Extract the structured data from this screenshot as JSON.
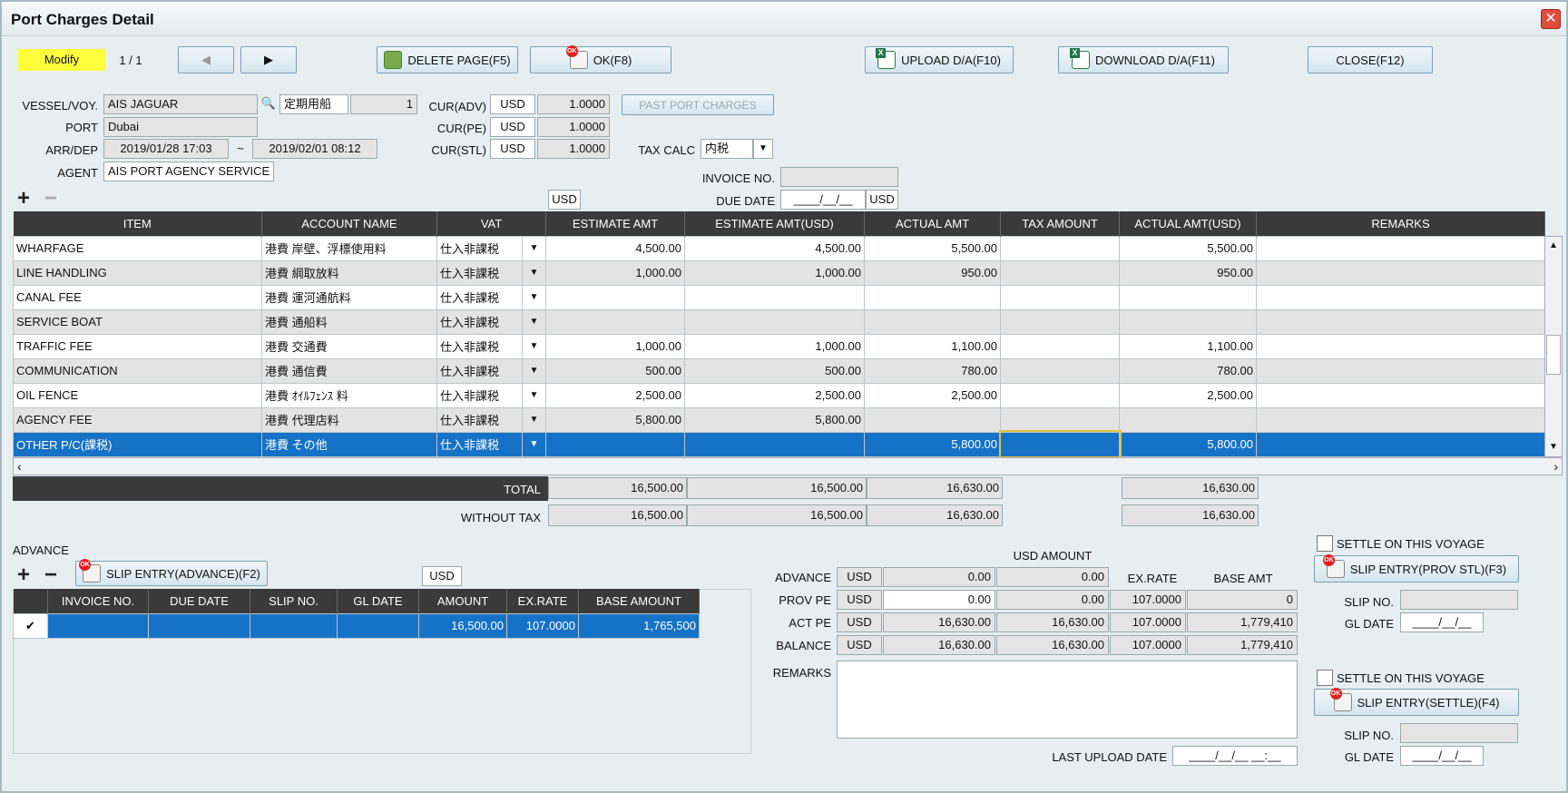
{
  "window": {
    "title": "Port Charges Detail",
    "close_glyph": "✕"
  },
  "toolbar": {
    "mode": "Modify",
    "page_counter": "1 / 1",
    "prev_glyph": "◀",
    "next_glyph": "▶",
    "delete_page": "DELETE PAGE(F5)",
    "ok": "OK(F8)",
    "upload": "UPLOAD D/A(F10)",
    "download": "DOWNLOAD D/A(F11)",
    "close": "CLOSE(F12)"
  },
  "header": {
    "vessel_label": "VESSEL/VOY.",
    "vessel": "AIS JAGUAR",
    "voyage_type": "定期用船",
    "voyage_no": "1",
    "port_label": "PORT",
    "port": "Dubai",
    "arrdep_label": "ARR/DEP",
    "arr": "2019/01/28 17:03",
    "tilde": "~",
    "dep": "2019/02/01 08:12",
    "agent_label": "AGENT",
    "agent": "AIS PORT AGENCY SERVICE",
    "cur_adv_label": "CUR(ADV)",
    "cur_adv": "USD",
    "rate_adv": "1.0000",
    "cur_pe_label": "CUR(PE)",
    "cur_pe": "USD",
    "rate_pe": "1.0000",
    "cur_stl_label": "CUR(STL)",
    "cur_stl": "USD",
    "rate_stl": "1.0000",
    "past_port_charges": "PAST PORT CHARGES",
    "tax_calc_label": "TAX CALC",
    "tax_calc": "内税",
    "invoice_no_label": "INVOICE NO.",
    "invoice_no": "",
    "due_date_label": "DUE DATE",
    "due_date": "____/__/__",
    "due_cur": "USD",
    "grid_cur": "USD"
  },
  "charges": {
    "columns": [
      "ITEM",
      "ACCOUNT NAME",
      "VAT",
      "ESTIMATE AMT",
      "ESTIMATE AMT(USD)",
      "ACTUAL AMT",
      "TAX AMOUNT",
      "ACTUAL AMT(USD)",
      "REMARKS"
    ],
    "rows": [
      {
        "item": "WHARFAGE",
        "account": "港費 岸壁、浮標使用料",
        "vat": "仕入非課税",
        "est": "4,500.00",
        "est_usd": "4,500.00",
        "act": "5,500.00",
        "tax": "",
        "act_usd": "5,500.00",
        "remarks": ""
      },
      {
        "item": "LINE HANDLING",
        "account": "港費 綱取放料",
        "vat": "仕入非課税",
        "est": "1,000.00",
        "est_usd": "1,000.00",
        "act": "950.00",
        "tax": "",
        "act_usd": "950.00",
        "remarks": ""
      },
      {
        "item": "CANAL FEE",
        "account": "港費 運河通航料",
        "vat": "仕入非課税",
        "est": "",
        "est_usd": "",
        "act": "",
        "tax": "",
        "act_usd": "",
        "remarks": ""
      },
      {
        "item": "SERVICE BOAT",
        "account": "港費 通船料",
        "vat": "仕入非課税",
        "est": "",
        "est_usd": "",
        "act": "",
        "tax": "",
        "act_usd": "",
        "remarks": ""
      },
      {
        "item": "TRAFFIC FEE",
        "account": "港費 交通費",
        "vat": "仕入非課税",
        "est": "1,000.00",
        "est_usd": "1,000.00",
        "act": "1,100.00",
        "tax": "",
        "act_usd": "1,100.00",
        "remarks": ""
      },
      {
        "item": "COMMUNICATION",
        "account": "港費 通信費",
        "vat": "仕入非課税",
        "est": "500.00",
        "est_usd": "500.00",
        "act": "780.00",
        "tax": "",
        "act_usd": "780.00",
        "remarks": ""
      },
      {
        "item": "OIL FENCE",
        "account": "港費 ｵｲﾙﾌｪﾝｽ 料",
        "vat": "仕入非課税",
        "est": "2,500.00",
        "est_usd": "2,500.00",
        "act": "2,500.00",
        "tax": "",
        "act_usd": "2,500.00",
        "remarks": ""
      },
      {
        "item": "AGENCY FEE",
        "account": "港費 代理店料",
        "vat": "仕入非課税",
        "est": "5,800.00",
        "est_usd": "5,800.00",
        "act": "",
        "tax": "",
        "act_usd": "",
        "remarks": ""
      },
      {
        "item": "OTHER P/C(課税)",
        "account": "港費 その他",
        "vat": "仕入非課税",
        "est": "",
        "est_usd": "",
        "act": "5,800.00",
        "tax": "",
        "act_usd": "5,800.00",
        "remarks": ""
      }
    ],
    "total_label": "TOTAL",
    "total": {
      "est": "16,500.00",
      "est_usd": "16,500.00",
      "act": "16,630.00",
      "act_usd": "16,630.00"
    },
    "without_tax_label": "WITHOUT TAX",
    "without_tax": {
      "est": "16,500.00",
      "est_usd": "16,500.00",
      "act": "16,630.00",
      "act_usd": "16,630.00"
    }
  },
  "advance": {
    "label": "ADVANCE",
    "slip_entry": "SLIP ENTRY(ADVANCE)(F2)",
    "currency": "USD",
    "columns": [
      "",
      "INVOICE NO.",
      "DUE DATE",
      "SLIP NO.",
      "GL DATE",
      "AMOUNT",
      "EX.RATE",
      "BASE AMOUNT"
    ],
    "rows": [
      {
        "checked": "✔",
        "invoice": "",
        "due": "",
        "slip": "",
        "gl": "",
        "amount": "16,500.00",
        "rate": "107.0000",
        "base": "1,765,500"
      }
    ]
  },
  "summary": {
    "usd_amount_label": "USD AMOUNT",
    "ex_rate_label": "EX.RATE",
    "base_amt_label": "BASE AMT",
    "rows": [
      {
        "label": "ADVANCE",
        "cur": "USD",
        "amt": "0.00",
        "usd": "0.00",
        "rate": "",
        "base": ""
      },
      {
        "label": "PROV PE",
        "cur": "USD",
        "amt": "0.00",
        "usd": "0.00",
        "rate": "107.0000",
        "base": "0"
      },
      {
        "label": "ACT PE",
        "cur": "USD",
        "amt": "16,630.00",
        "usd": "16,630.00",
        "rate": "107.0000",
        "base": "1,779,410"
      },
      {
        "label": "BALANCE",
        "cur": "USD",
        "amt": "16,630.00",
        "usd": "16,630.00",
        "rate": "107.0000",
        "base": "1,779,410"
      }
    ],
    "remarks_label": "REMARKS",
    "remarks": "",
    "last_upload_label": "LAST UPLOAD DATE",
    "last_upload": "____/__/__ __:__"
  },
  "settle": {
    "settle_label": "SETTLE ON THIS VOYAGE",
    "prov_stl": "SLIP ENTRY(PROV STL)(F3)",
    "settle_btn": "SLIP ENTRY(SETTLE)(F4)",
    "slip_no_label": "SLIP NO.",
    "gl_date_label": "GL DATE",
    "gl_date_value": "____/__/__"
  },
  "colors": {
    "selected_row": "#1672c6",
    "mode_bg": "#ffff3b",
    "header_bg": "#3a3a3a"
  }
}
